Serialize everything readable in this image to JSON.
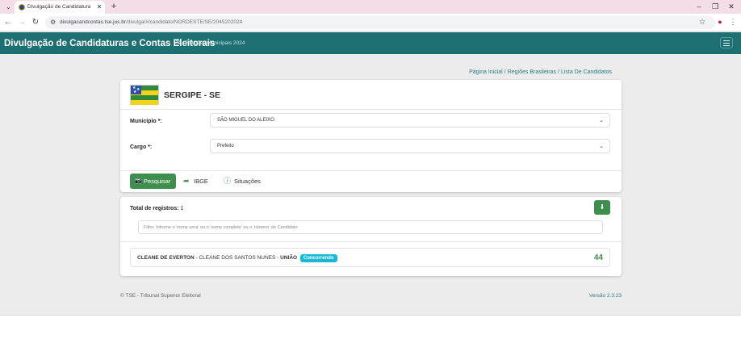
{
  "browser": {
    "tab_title": "Divulgação de Candidaturas e C",
    "url_host": "divulgacandcontas.tse.jus.br",
    "url_path": "/divulga/#/candidato/NORDESTE/SE/2045202024"
  },
  "header": {
    "title": "Divulgação de Candidaturas e Contas Eleitorais",
    "subtitle": "Eleições Municipais 2024"
  },
  "breadcrumb": [
    "Página Inicial",
    "Regiões Brasileiras",
    "Lista De Candidatos"
  ],
  "state": {
    "title": "SERGIPE - SE"
  },
  "form": {
    "municipio_label": "Município *:",
    "municipio_value": "SÃO MIGUEL DO ALEIXO",
    "cargo_label": "Cargo *:",
    "cargo_value": "Prefeito"
  },
  "actions": {
    "pesquisar": "Pesquisar",
    "ibge": "IBGE",
    "situacoes": "Situações"
  },
  "results": {
    "total_label": "Total de registros:",
    "total_value": "1",
    "filter_placeholder": "Filtro: Informe o 'nome urna' ou o 'nome completo' ou o 'número' do Candidato",
    "candidates": [
      {
        "nome_urna": "CLEANE DE EVERTON",
        "nome_completo": "CLEANE DOS SANTOS NUNES",
        "partido": "UNIÃO",
        "status": "Concorrendo",
        "numero": "44"
      }
    ]
  },
  "footer": {
    "left": "© TSE - Tribunal Superior Eleitoral",
    "right": "Versão 2.3.23"
  },
  "colors": {
    "header": "#1e6f71",
    "primary_button": "#3e8e4d",
    "badge": "#18b9d4",
    "link": "#2d7f86"
  }
}
